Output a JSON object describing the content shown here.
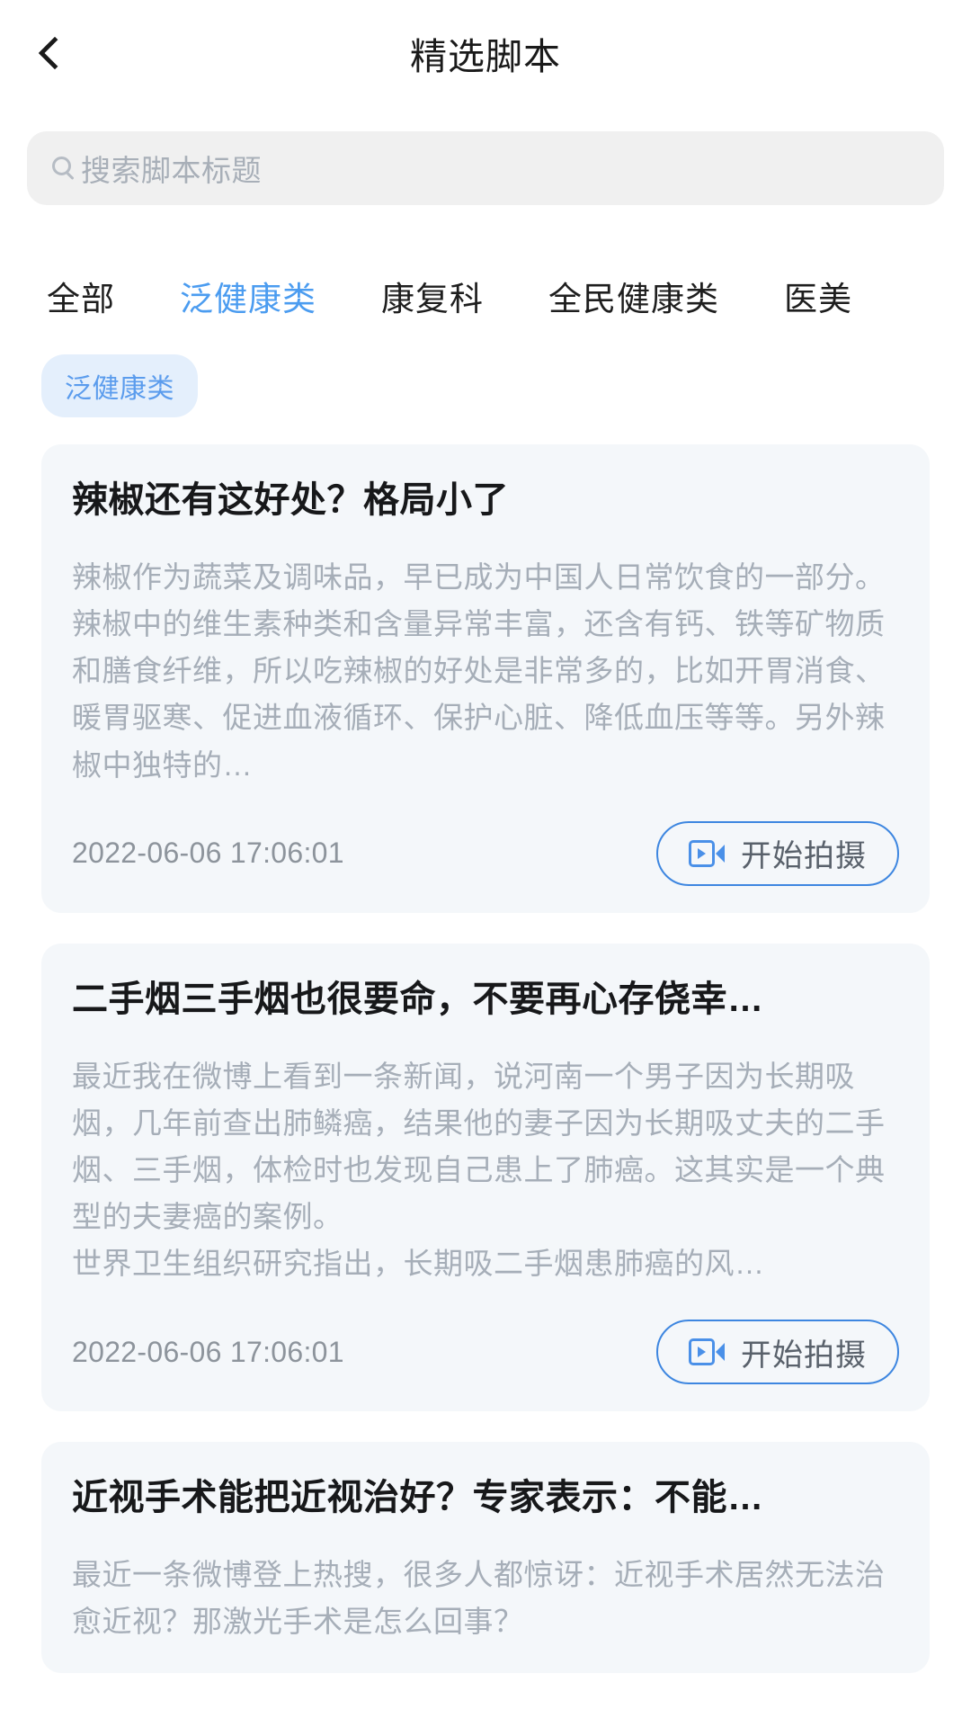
{
  "header": {
    "title": "精选脚本",
    "back_icon": "chevron-left-icon"
  },
  "search": {
    "icon": "search-icon",
    "placeholder": "搜索脚本标题",
    "value": ""
  },
  "tabs": [
    {
      "label": "全部",
      "active": false
    },
    {
      "label": "泛健康类",
      "active": true
    },
    {
      "label": "康复科",
      "active": false
    },
    {
      "label": "全民健康类",
      "active": false
    },
    {
      "label": "医美",
      "active": false
    }
  ],
  "chips": [
    {
      "label": "泛健康类",
      "selected": true
    }
  ],
  "cards": [
    {
      "title": "辣椒还有这好处？格局小了",
      "body": "辣椒作为蔬菜及调味品，早已成为中国人日常饮食的一部分。辣椒中的维生素种类和含量异常丰富，还含有钙、铁等矿物质和膳食纤维，所以吃辣椒的好处是非常多的，比如开胃消食、暖胃驱寒、促进血液循环、保护心脏、降低血压等等。另外辣椒中独特的…",
      "date": "2022-06-06 17:06:01",
      "button_label": "开始拍摄",
      "button_icon": "video-camera-icon"
    },
    {
      "title": "二手烟三手烟也很要命，不要再心存侥幸…",
      "body": "最近我在微博上看到一条新闻，说河南一个男子因为长期吸烟，几年前查出肺鳞癌，结果他的妻子因为长期吸丈夫的二手烟、三手烟，体检时也发现自己患上了肺癌。这其实是一个典型的夫妻癌的案例。\n世界卫生组织研究指出，长期吸二手烟患肺癌的风…",
      "date": "2022-06-06 17:06:01",
      "button_label": "开始拍摄",
      "button_icon": "video-camera-icon"
    },
    {
      "title": "近视手术能把近视治好？专家表示：不能…",
      "body": "最近一条微博登上热搜，很多人都惊讶：近视手术居然无法治愈近视？那激光手术是怎么回事？",
      "date": "",
      "button_label": "",
      "button_icon": ""
    }
  ],
  "colors": {
    "accent": "#4b9cf0",
    "chip_bg": "#e4effc",
    "card_bg": "#f4f7fa",
    "body_text": "#a6aeb8",
    "title_text": "#17181a",
    "button_border": "#3d86e0"
  }
}
